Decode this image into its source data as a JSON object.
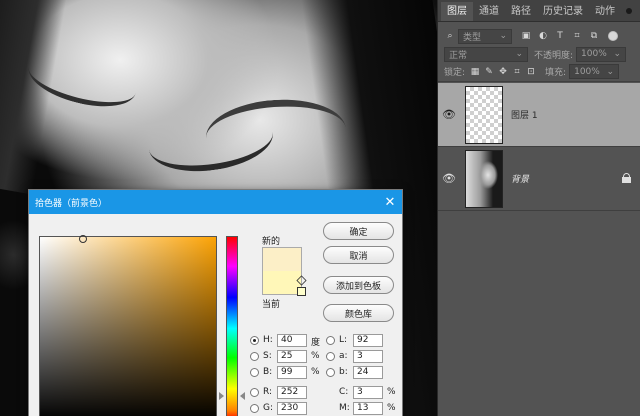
{
  "layers_panel": {
    "tabs": [
      "图层",
      "通道",
      "路径",
      "历史记录",
      "动作"
    ],
    "active_tab": "图层",
    "filter_label": "类型",
    "blend_mode": "正常",
    "opacity_label": "不透明度:",
    "opacity_value": "100%",
    "lock_label": "锁定:",
    "fill_label": "填充:",
    "fill_value": "100%",
    "layers": [
      {
        "name": "图层 1",
        "selected": true
      },
      {
        "name": "背景",
        "selected": false,
        "locked": true
      }
    ]
  },
  "color_picker": {
    "title": "拾色器（前景色）",
    "close_glyph": "✕",
    "new_label": "新的",
    "current_label": "当前",
    "new_color": "#fcefc7",
    "current_color": "#fff7b8",
    "buttons": {
      "ok": "确定",
      "cancel": "取消",
      "add_to_swatches": "添加到色板",
      "color_libraries": "颜色库"
    },
    "hsb": {
      "H": {
        "label": "H:",
        "value": "40",
        "unit": "度"
      },
      "S": {
        "label": "S:",
        "value": "25",
        "unit": "%"
      },
      "B": {
        "label": "B:",
        "value": "99",
        "unit": "%"
      }
    },
    "rgb": {
      "R": {
        "label": "R:",
        "value": "252"
      },
      "G": {
        "label": "G:",
        "value": "230"
      }
    },
    "lab": {
      "L": {
        "label": "L:",
        "value": "92"
      },
      "a": {
        "label": "a:",
        "value": "3"
      },
      "b": {
        "label": "b:",
        "value": "24"
      }
    },
    "cmyk": {
      "C": {
        "label": "C:",
        "value": "3",
        "unit": "%"
      },
      "M": {
        "label": "M:",
        "value": "13",
        "unit": "%"
      }
    },
    "selected_mode": "H",
    "hue_field_color": "#fca305"
  }
}
